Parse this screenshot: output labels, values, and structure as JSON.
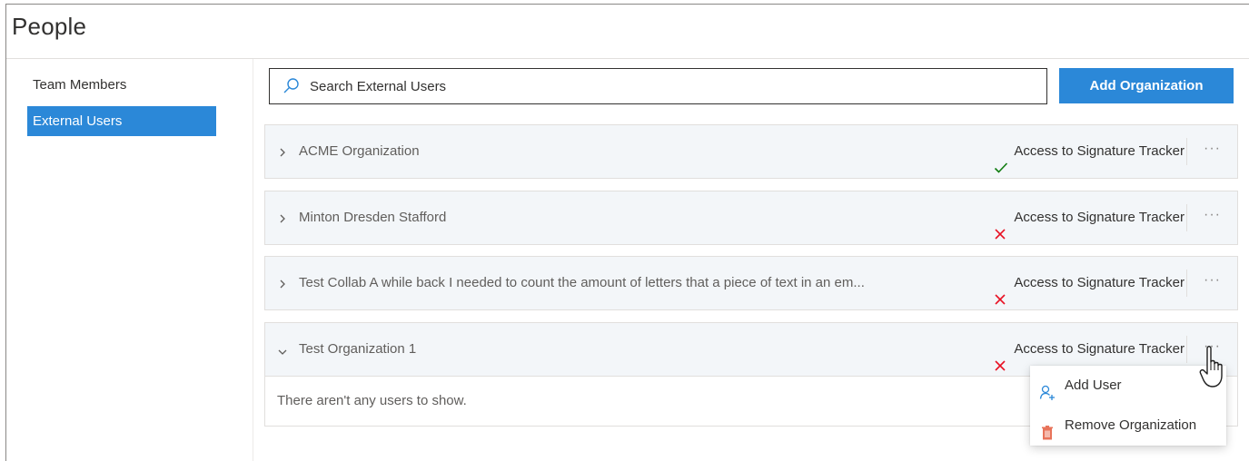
{
  "page": {
    "title": "People"
  },
  "sidebar": {
    "items": [
      {
        "label": "Team Members",
        "selected": false
      },
      {
        "label": "External Users",
        "selected": true
      }
    ]
  },
  "search": {
    "placeholder": "Search External Users",
    "value": "",
    "icon": "search-icon"
  },
  "toolbar": {
    "add_organization_label": "Add Organization"
  },
  "organizations": [
    {
      "name": "ACME Organization",
      "expanded": false,
      "access_label": "Access to Signature Tracker",
      "access": true,
      "more": "···"
    },
    {
      "name": "Minton Dresden Stafford",
      "expanded": false,
      "access_label": "Access to Signature Tracker",
      "access": false,
      "more": "···"
    },
    {
      "name": "Test Collab A while back I needed to count the amount of letters that a piece of text in an em...",
      "expanded": false,
      "access_label": "Access to Signature Tracker",
      "access": false,
      "more": "···"
    },
    {
      "name": "Test Organization 1",
      "expanded": true,
      "access_label": "Access to Signature Tracker",
      "access": false,
      "more": "···",
      "empty_message": "There aren't any users to show."
    }
  ],
  "context_menu": {
    "items": [
      {
        "label": "Add User",
        "icon": "add-user-icon"
      },
      {
        "label": "Remove Organization",
        "icon": "trash-icon"
      }
    ]
  },
  "colors": {
    "accent": "#2b88d8",
    "check": "#107c10",
    "cross": "#e81123",
    "danger_icon": "#e8735a"
  }
}
